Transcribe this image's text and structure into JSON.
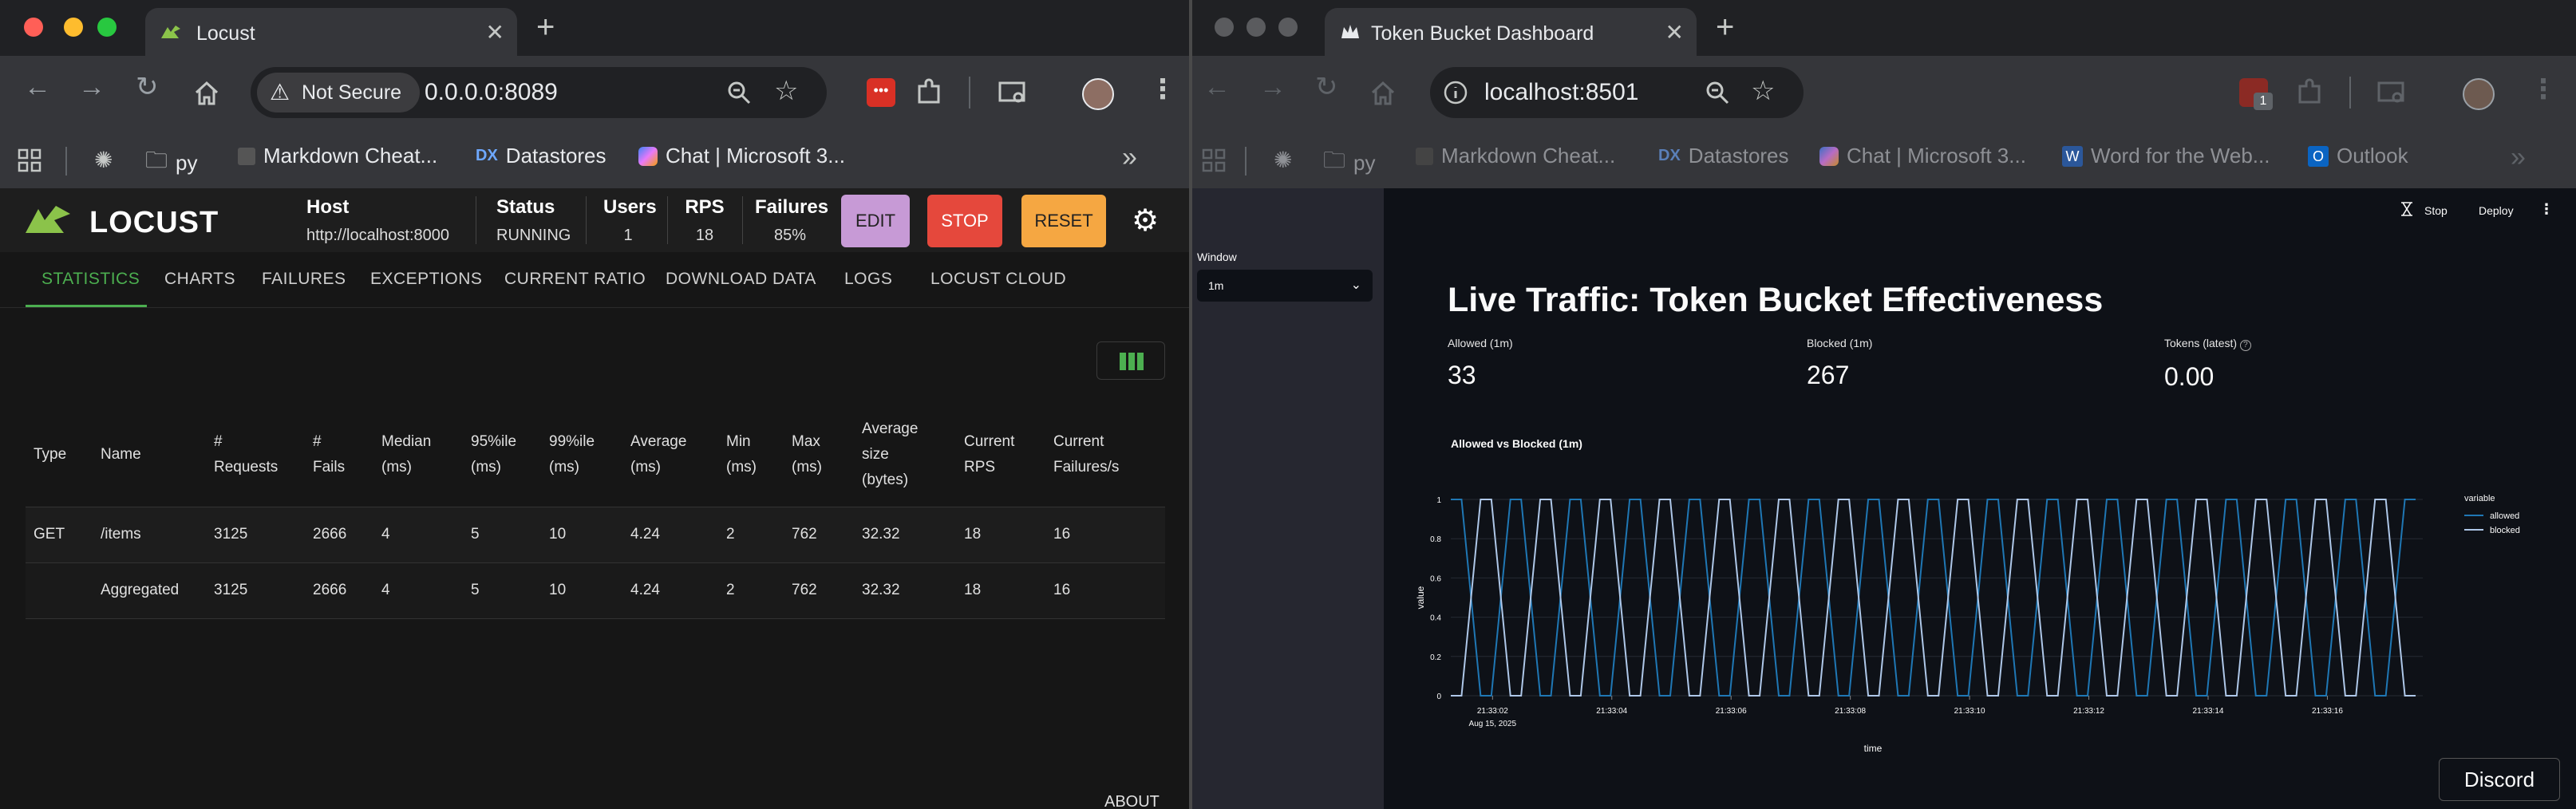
{
  "left_browser": {
    "tab_title": "Locust",
    "url_security": "Not Secure",
    "url": "0.0.0.0:8089",
    "bookmarks": [
      "py",
      "Markdown Cheat...",
      "Datastores",
      "Chat | Microsoft 3..."
    ],
    "locust": {
      "logo_text": "LOCUST",
      "stats": [
        {
          "label": "Host",
          "value": "http://localhost:8000"
        },
        {
          "label": "Status",
          "value": "RUNNING"
        },
        {
          "label": "Users",
          "value": "1"
        },
        {
          "label": "RPS",
          "value": "18"
        },
        {
          "label": "Failures",
          "value": "85%"
        }
      ],
      "buttons": {
        "edit": "EDIT",
        "stop": "STOP",
        "reset": "RESET"
      },
      "tabs": [
        "STATISTICS",
        "CHARTS",
        "FAILURES",
        "EXCEPTIONS",
        "CURRENT RATIO",
        "DOWNLOAD DATA",
        "LOGS",
        "LOCUST CLOUD"
      ],
      "table": {
        "headers": [
          [
            "Type"
          ],
          [
            "Name"
          ],
          [
            "#",
            "Requests"
          ],
          [
            "#",
            "Fails"
          ],
          [
            "Median",
            "(ms)"
          ],
          [
            "95%ile",
            "(ms)"
          ],
          [
            "99%ile",
            "(ms)"
          ],
          [
            "Average",
            "(ms)"
          ],
          [
            "Min",
            "(ms)"
          ],
          [
            "Max",
            "(ms)"
          ],
          [
            "Average",
            "size",
            "(bytes)"
          ],
          [
            "Current",
            "RPS"
          ],
          [
            "Current",
            "Failures/s"
          ]
        ],
        "rows": [
          [
            "GET",
            "/items",
            "3125",
            "2666",
            "4",
            "5",
            "10",
            "4.24",
            "2",
            "762",
            "32.32",
            "18",
            "16"
          ],
          [
            "",
            "Aggregated",
            "3125",
            "2666",
            "4",
            "5",
            "10",
            "4.24",
            "2",
            "762",
            "32.32",
            "18",
            "16"
          ]
        ]
      },
      "footer_link": "ABOUT"
    }
  },
  "right_browser": {
    "tab_title": "Token Bucket Dashboard",
    "url": "localhost:8501",
    "extension_badge": "1",
    "bookmarks": [
      "py",
      "Markdown Cheat...",
      "Datastores",
      "Chat | Microsoft 3...",
      "Word for the Web...",
      "Outlook"
    ],
    "app": {
      "header_stop": "Stop",
      "header_deploy": "Deploy",
      "sidebar": {
        "select_label": "Window",
        "select_value": "1m"
      },
      "title": "Live Traffic: Token Bucket Effectiveness",
      "metrics": [
        {
          "label": "Allowed (1m)",
          "value": "33"
        },
        {
          "label": "Blocked (1m)",
          "value": "267"
        },
        {
          "label": "Tokens (latest)",
          "value": "0.00"
        }
      ],
      "chart_title": "Allowed vs Blocked (1m)",
      "discord_label": "Discord"
    }
  },
  "colors": {
    "locust_green": "#4caf50",
    "edit_button": "#c79ad6",
    "stop_button": "#e5483c",
    "reset_button": "#f5a742",
    "allowed_line": "#1f77b4",
    "blocked_line": "#aec7e8"
  },
  "chart_data": {
    "type": "line",
    "title": "Allowed vs Blocked (1m)",
    "xlabel": "time",
    "ylabel": "value",
    "ylim": [
      0,
      1
    ],
    "y_ticks": [
      "0",
      "0.2",
      "0.4",
      "0.6",
      "0.8",
      "1"
    ],
    "x_ticks": [
      "21:33:02",
      "21:33:04",
      "21:33:06",
      "21:33:08",
      "21:33:10",
      "21:33:12",
      "21:33:14",
      "21:33:16"
    ],
    "x_tick_sublabel": "Aug 15, 2025",
    "x_range": [
      "21:33:01.3",
      "21:33:17.6"
    ],
    "legend": {
      "title": "variable",
      "position": "right"
    },
    "series": [
      {
        "name": "allowed",
        "color": "#1f77b4"
      },
      {
        "name": "blocked",
        "color": "#aec7e8"
      }
    ],
    "x_event_seconds": [
      1.3,
      1.8,
      2.3,
      2.8,
      3.3,
      3.8,
      4.3,
      4.8,
      5.3,
      5.8,
      6.3,
      6.8,
      7.3,
      7.8,
      8.3,
      8.8,
      9.3,
      9.8,
      10.3,
      10.8,
      11.3,
      11.8,
      12.3,
      12.8,
      13.3,
      13.8,
      14.3,
      14.8,
      15.3,
      15.8,
      16.3,
      16.8,
      17.3
    ],
    "pattern_note": "allowed and blocked alternate between 0 and 1 in opposite phase"
  }
}
